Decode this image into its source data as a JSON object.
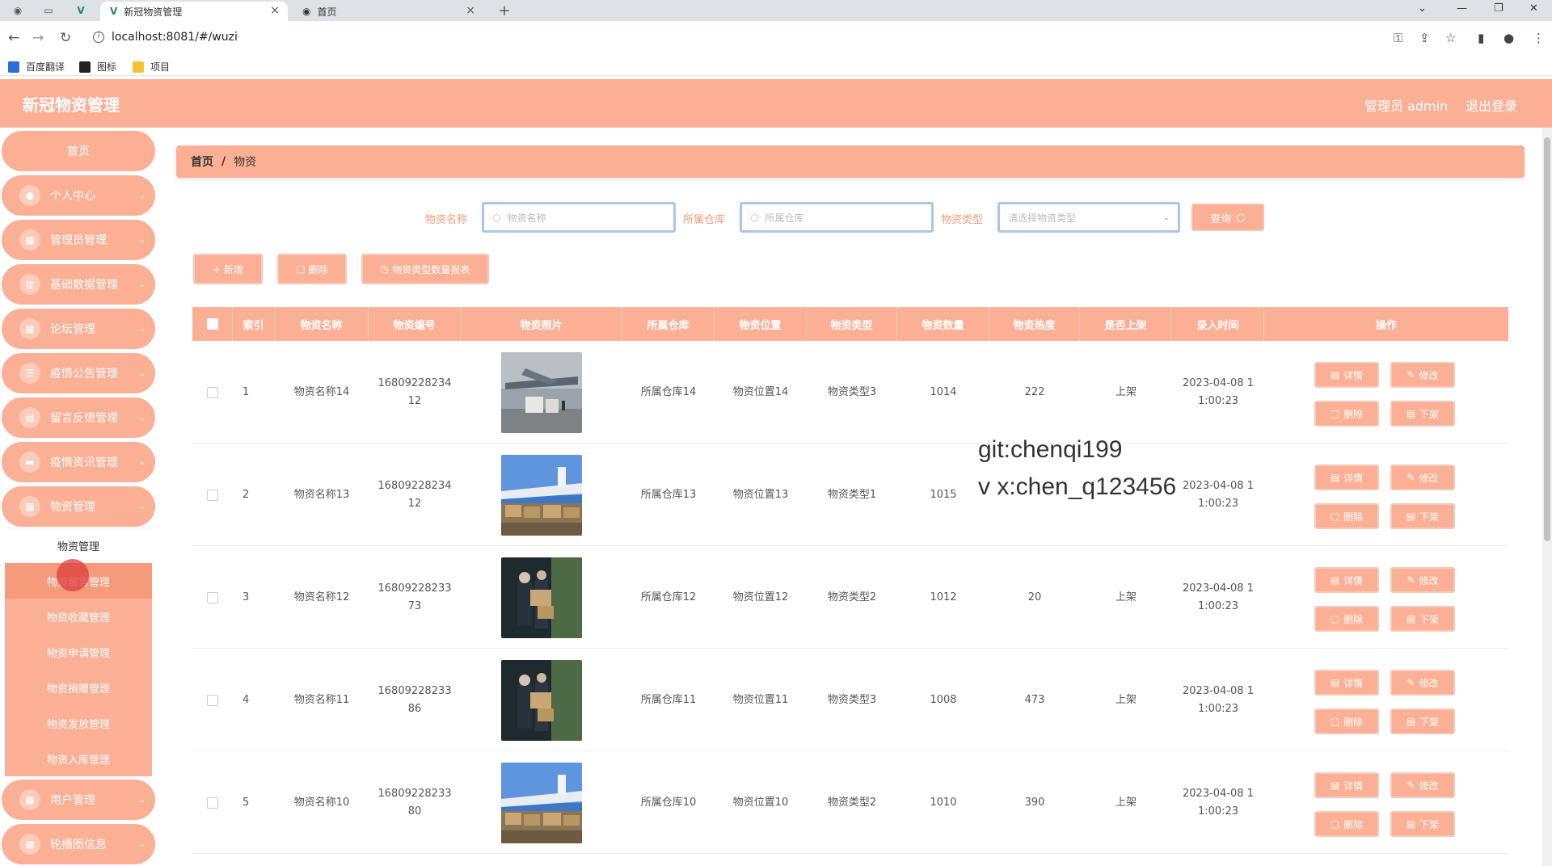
{
  "browser": {
    "tabs": [
      {
        "title": "新冠物资管理",
        "active": true
      },
      {
        "title": "首页",
        "active": false
      }
    ],
    "url": "localhost:8081/#/wuzi",
    "bookmarks": [
      "百度翻译",
      "图标",
      "项目"
    ]
  },
  "header": {
    "title": "新冠物资管理",
    "admin": "管理员 admin",
    "logout": "退出登录"
  },
  "sidebar": {
    "home": "首页",
    "items": [
      {
        "label": "个人中心",
        "icon": "user-icon"
      },
      {
        "label": "管理员管理",
        "icon": "grid-icon"
      },
      {
        "label": "基础数据管理",
        "icon": "bar-chart-icon"
      },
      {
        "label": "论坛管理",
        "icon": "grid-icon"
      },
      {
        "label": "疫情公告管理",
        "icon": "list-icon"
      },
      {
        "label": "留言反馈管理",
        "icon": "clipboard-icon"
      },
      {
        "label": "疫情资讯管理",
        "icon": "monitor-icon"
      },
      {
        "label": "物资管理",
        "icon": "grid-icon"
      }
    ],
    "submenu": [
      "物资管理",
      "物资留言管理",
      "物资收藏管理",
      "物资申请管理",
      "物资捐赠管理",
      "物资发放管理",
      "物资入库管理"
    ],
    "bottom_items": [
      {
        "label": "用户管理",
        "icon": "grid-icon"
      },
      {
        "label": "轮播图信息",
        "icon": "grid-icon"
      }
    ]
  },
  "breadcrumb": {
    "home": "首页",
    "sep": "/",
    "current": "物资"
  },
  "filters": {
    "name_label": "物资名称",
    "name_placeholder": "物资名称",
    "warehouse_label": "所属仓库",
    "warehouse_placeholder": "所属仓库",
    "type_label": "物资类型",
    "type_placeholder": "请选择物资类型",
    "query_button": "查询"
  },
  "actions": {
    "add": "+ 新增",
    "delete": "删除",
    "report": "物资类型数量报表"
  },
  "table": {
    "headers": [
      "索引",
      "物资名称",
      "物资编号",
      "物资照片",
      "所属仓库",
      "物资位置",
      "物资类型",
      "物资数量",
      "物资热度",
      "是否上架",
      "录入时间",
      "操作"
    ],
    "rows": [
      {
        "index": "1",
        "name": "物资名称14",
        "code1": "16809228234",
        "code2": "12",
        "photo": "plane-cargo",
        "warehouse": "所属仓库14",
        "location": "物资位置14",
        "type": "物资类型3",
        "qty": "1014",
        "heat": "222",
        "status": "上架",
        "time1": "2023-04-08 1",
        "time2": "1:00:23"
      },
      {
        "index": "2",
        "name": "物资名称13",
        "code1": "16809228234",
        "code2": "12",
        "photo": "plane-boxes",
        "warehouse": "所属仓库13",
        "location": "物资位置13",
        "type": "物资类型1",
        "qty": "1015",
        "heat": "",
        "status": "",
        "time1": "2023-04-08 1",
        "time2": "1:00:23"
      },
      {
        "index": "3",
        "name": "物资名称12",
        "code1": "16809228233",
        "code2": "73",
        "photo": "workers-loading",
        "warehouse": "所属仓库12",
        "location": "物资位置12",
        "type": "物资类型2",
        "qty": "1012",
        "heat": "20",
        "status": "上架",
        "time1": "2023-04-08 1",
        "time2": "1:00:23"
      },
      {
        "index": "4",
        "name": "物资名称11",
        "code1": "16809228233",
        "code2": "86",
        "photo": "workers-loading",
        "warehouse": "所属仓库11",
        "location": "物资位置11",
        "type": "物资类型3",
        "qty": "1008",
        "heat": "473",
        "status": "上架",
        "time1": "2023-04-08 1",
        "time2": "1:00:23"
      },
      {
        "index": "5",
        "name": "物资名称10",
        "code1": "16809228233",
        "code2": "80",
        "photo": "plane-boxes",
        "warehouse": "所属仓库10",
        "location": "物资位置10",
        "type": "物资类型2",
        "qty": "1010",
        "heat": "390",
        "status": "上架",
        "time1": "2023-04-08 1",
        "time2": "1:00:23"
      }
    ],
    "op_labels": {
      "detail": "详情",
      "edit": "修改",
      "delete": "删除",
      "offshelf": "下架"
    }
  },
  "watermark": {
    "line1": "git:chenqi199",
    "line2": "v x:chen_q123456"
  },
  "colors": {
    "accent": "#fbb096",
    "accent_dark": "#f59a7a",
    "focus_border": "#a9c6e8"
  }
}
